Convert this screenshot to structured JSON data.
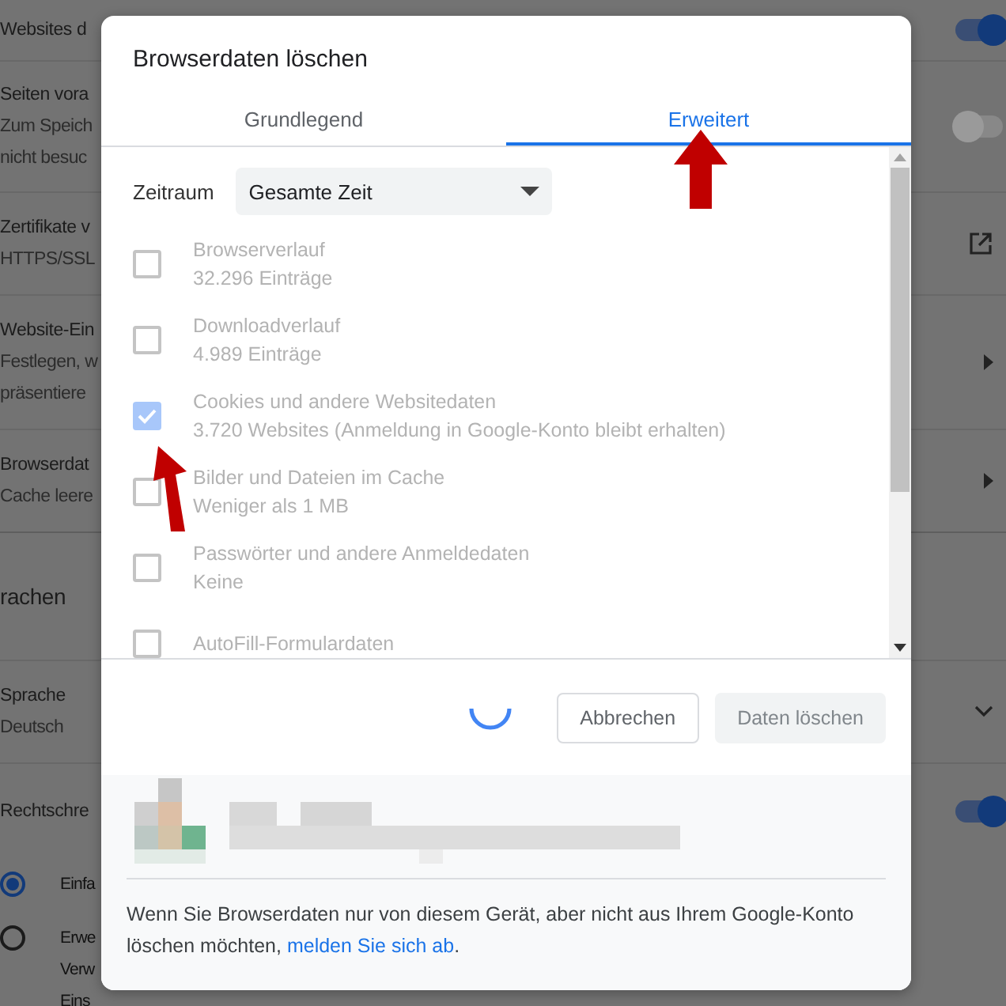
{
  "settings_page": {
    "rows": [
      {
        "kind": "toggle",
        "lines": [
          "Websites d"
        ],
        "on": true
      },
      {
        "kind": "toggle",
        "lines": [
          "Seiten vora",
          "Zum Speich",
          "nicht besuc"
        ],
        "on": false
      },
      {
        "kind": "external",
        "lines": [
          "Zertifikate v",
          "HTTPS/SSL"
        ]
      },
      {
        "kind": "arrow",
        "lines": [
          "Website-Ein",
          "Festlegen, w",
          "präsentiere"
        ]
      },
      {
        "kind": "arrow",
        "lines": [
          "Browserdat",
          "Cache leere"
        ]
      },
      {
        "kind": "header",
        "lines": [
          "rachen"
        ]
      },
      {
        "kind": "dropdown",
        "lines": [
          "Sprache",
          "Deutsch"
        ]
      },
      {
        "kind": "toggle",
        "lines": [
          "Rechtschre"
        ],
        "on": true
      },
      {
        "kind": "radio",
        "lines": [
          "Einfa"
        ],
        "selected": true
      },
      {
        "kind": "radio",
        "lines": [
          "Erwe",
          "Verw",
          "Eins"
        ],
        "selected": false
      }
    ]
  },
  "dialog": {
    "title": "Browserdaten löschen",
    "tabs": [
      {
        "label": "Grundlegend",
        "selected": false
      },
      {
        "label": "Erweitert",
        "selected": true
      }
    ],
    "time_range": {
      "label": "Zeitraum",
      "value": "Gesamte Zeit"
    },
    "items": [
      {
        "label": "Browserverlauf",
        "detail": "32.296 Einträge",
        "checked": false,
        "disabled": true
      },
      {
        "label": "Downloadverlauf",
        "detail": "4.989 Einträge",
        "checked": false,
        "disabled": true
      },
      {
        "label": "Cookies und andere Websitedaten",
        "detail": "3.720 Websites (Anmeldung in Google-Konto bleibt erhalten)",
        "checked": true,
        "disabled": true
      },
      {
        "label": "Bilder und Dateien im Cache",
        "detail": "Weniger als 1 MB",
        "checked": false,
        "disabled": true
      },
      {
        "label": "Passwörter und andere Anmeldedaten",
        "detail": "Keine",
        "checked": false,
        "disabled": true
      },
      {
        "label": "AutoFill-Formulardaten",
        "checked": false,
        "disabled": true
      }
    ],
    "loading": true,
    "buttons": [
      {
        "label": "Abbrechen",
        "kind": "secondary"
      },
      {
        "label": "Daten löschen",
        "kind": "primary_disabled"
      }
    ],
    "footer_text": "Wenn Sie Browserdaten nur von diesem Gerät, aber nicht aus Ihrem Google-Konto löschen möchten,",
    "footer_link": "melden Sie sich ab",
    "footer_end": "."
  }
}
